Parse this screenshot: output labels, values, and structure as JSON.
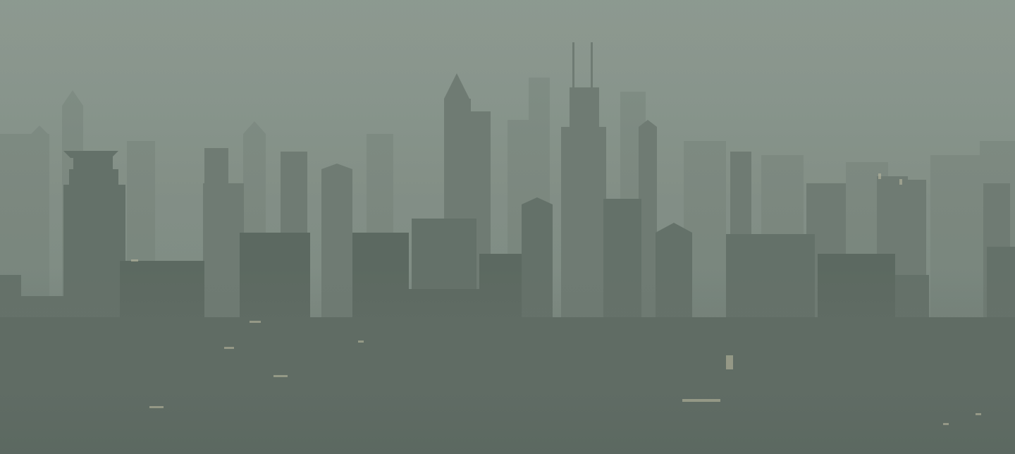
{
  "scene": {
    "subject": "city-skyline-in-haze",
    "palette": {
      "sky_top": "#8e9a92",
      "sky_mid": "#818d85",
      "haze": "#7a867e",
      "far_buildings": "#76827a",
      "mid_buildings": "#6b776f",
      "near_buildings": "#5f6b63",
      "ground": "#56625a",
      "light_glint": "#c9c2a6"
    }
  }
}
